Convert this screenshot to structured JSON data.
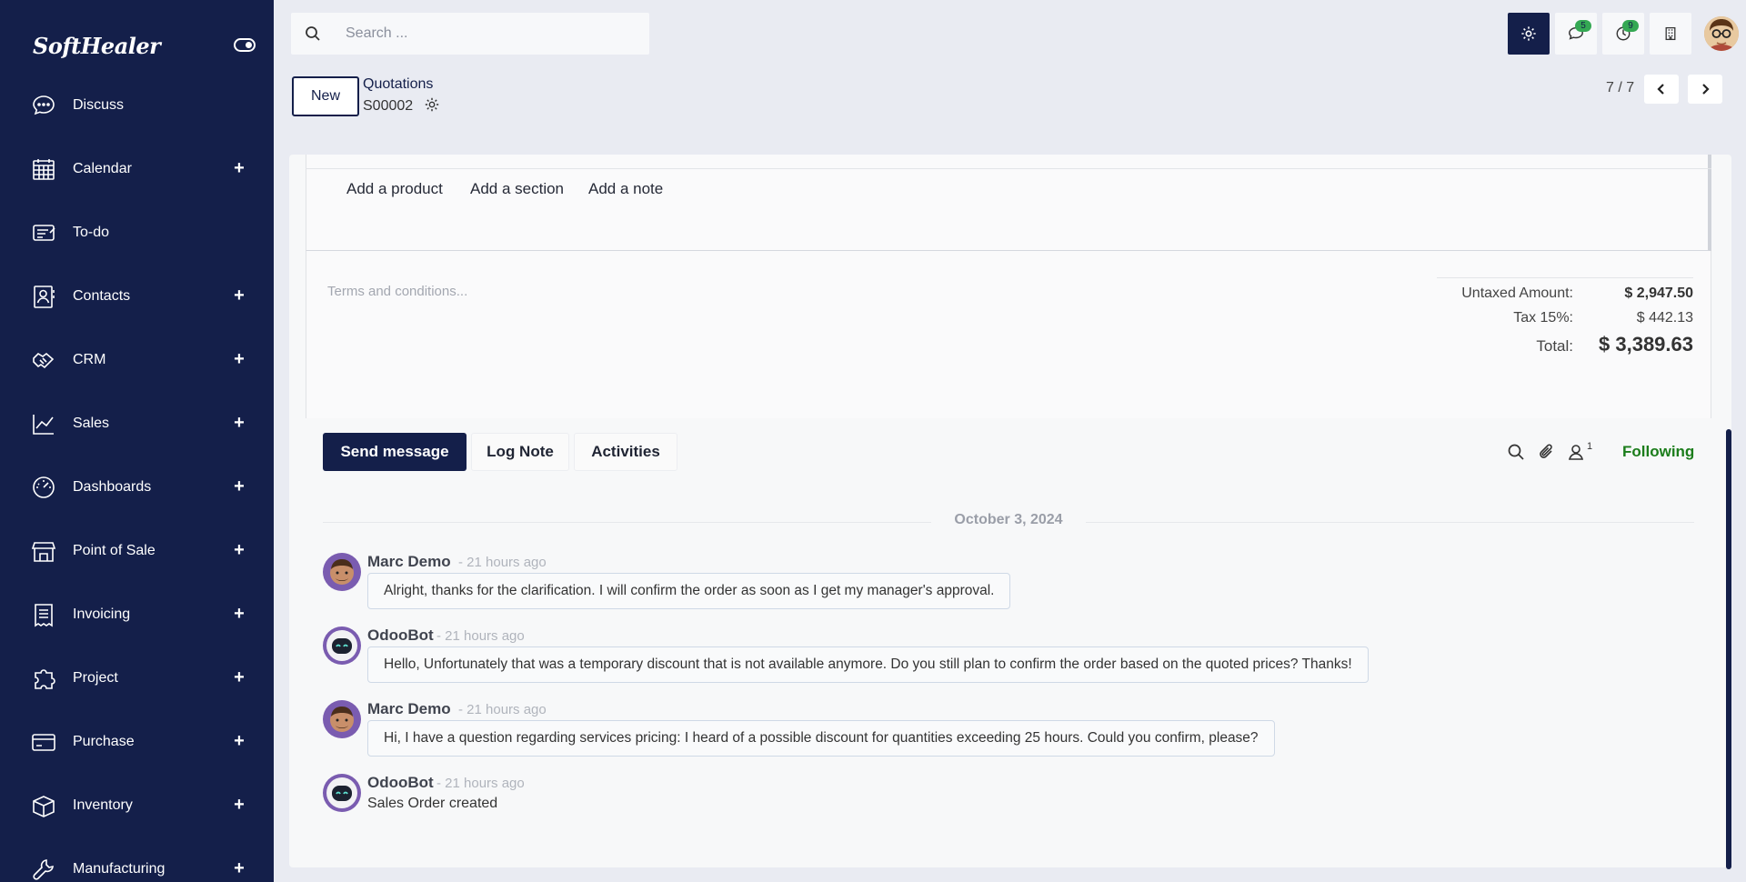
{
  "app": {
    "brand": "SoftHealer"
  },
  "sidebar": {
    "items": [
      {
        "label": "Discuss",
        "icon": "chat-bubble-icon",
        "has_plus": false
      },
      {
        "label": "Calendar",
        "icon": "calendar-icon",
        "has_plus": true
      },
      {
        "label": "To-do",
        "icon": "todo-icon",
        "has_plus": false
      },
      {
        "label": "Contacts",
        "icon": "contacts-icon",
        "has_plus": true
      },
      {
        "label": "CRM",
        "icon": "handshake-icon",
        "has_plus": true
      },
      {
        "label": "Sales",
        "icon": "trend-chart-icon",
        "has_plus": true
      },
      {
        "label": "Dashboards",
        "icon": "speedometer-icon",
        "has_plus": true
      },
      {
        "label": "Point of Sale",
        "icon": "store-icon",
        "has_plus": true
      },
      {
        "label": "Invoicing",
        "icon": "receipt-icon",
        "has_plus": true
      },
      {
        "label": "Project",
        "icon": "puzzle-icon",
        "has_plus": true
      },
      {
        "label": "Purchase",
        "icon": "credit-card-icon",
        "has_plus": true
      },
      {
        "label": "Inventory",
        "icon": "box-icon",
        "has_plus": true
      },
      {
        "label": "Manufacturing",
        "icon": "wrench-icon",
        "has_plus": true
      }
    ],
    "plus_glyph": "+"
  },
  "topbar": {
    "search": {
      "placeholder": "Search ...",
      "value": ""
    },
    "messages_badge": "5",
    "activities_badge": "9"
  },
  "control": {
    "new_label": "New",
    "breadcrumb_parent": "Quotations",
    "record_name": "S00002",
    "pager_value": "7 / 7"
  },
  "lines": {
    "add_product": "Add a product",
    "add_section": "Add a section",
    "add_note": "Add a note"
  },
  "notes": {
    "terms_placeholder": "Terms and conditions..."
  },
  "totals": {
    "untaxed_label": "Untaxed Amount:",
    "untaxed_value": "$ 2,947.50",
    "tax_label": "Tax 15%:",
    "tax_value": "$ 442.13",
    "total_label": "Total:",
    "total_value": "$ 3,389.63"
  },
  "chatter": {
    "send_message": "Send message",
    "log_note": "Log Note",
    "activities": "Activities",
    "follower_count": "1",
    "following": "Following",
    "date": "October 3, 2024",
    "messages": [
      {
        "author": "Marc Demo",
        "time": "- 21 hours ago",
        "body": "Alright, thanks for the clarification. I will confirm the order as soon as I get my manager's approval.",
        "avatar": "marc"
      },
      {
        "author": "OdooBot",
        "time": "- 21 hours ago",
        "body": "Hello, Unfortunately that was a temporary discount that is not available anymore. Do you still plan to confirm the order based on the quoted prices? Thanks!",
        "avatar": "bot"
      },
      {
        "author": "Marc Demo",
        "time": "- 21 hours ago",
        "body": "Hi, I have a question regarding services pricing: I heard of a possible discount for quantities exceeding 25 hours. Could you confirm, please?",
        "avatar": "marc"
      },
      {
        "author": "OdooBot",
        "time": "- 21 hours ago",
        "body": "Sales Order created",
        "avatar": "bot"
      }
    ]
  },
  "colors": {
    "sidebar_bg": "#141f4a",
    "accent": "#141f4a",
    "badge": "#34a853",
    "following": "#1b7d1b"
  }
}
